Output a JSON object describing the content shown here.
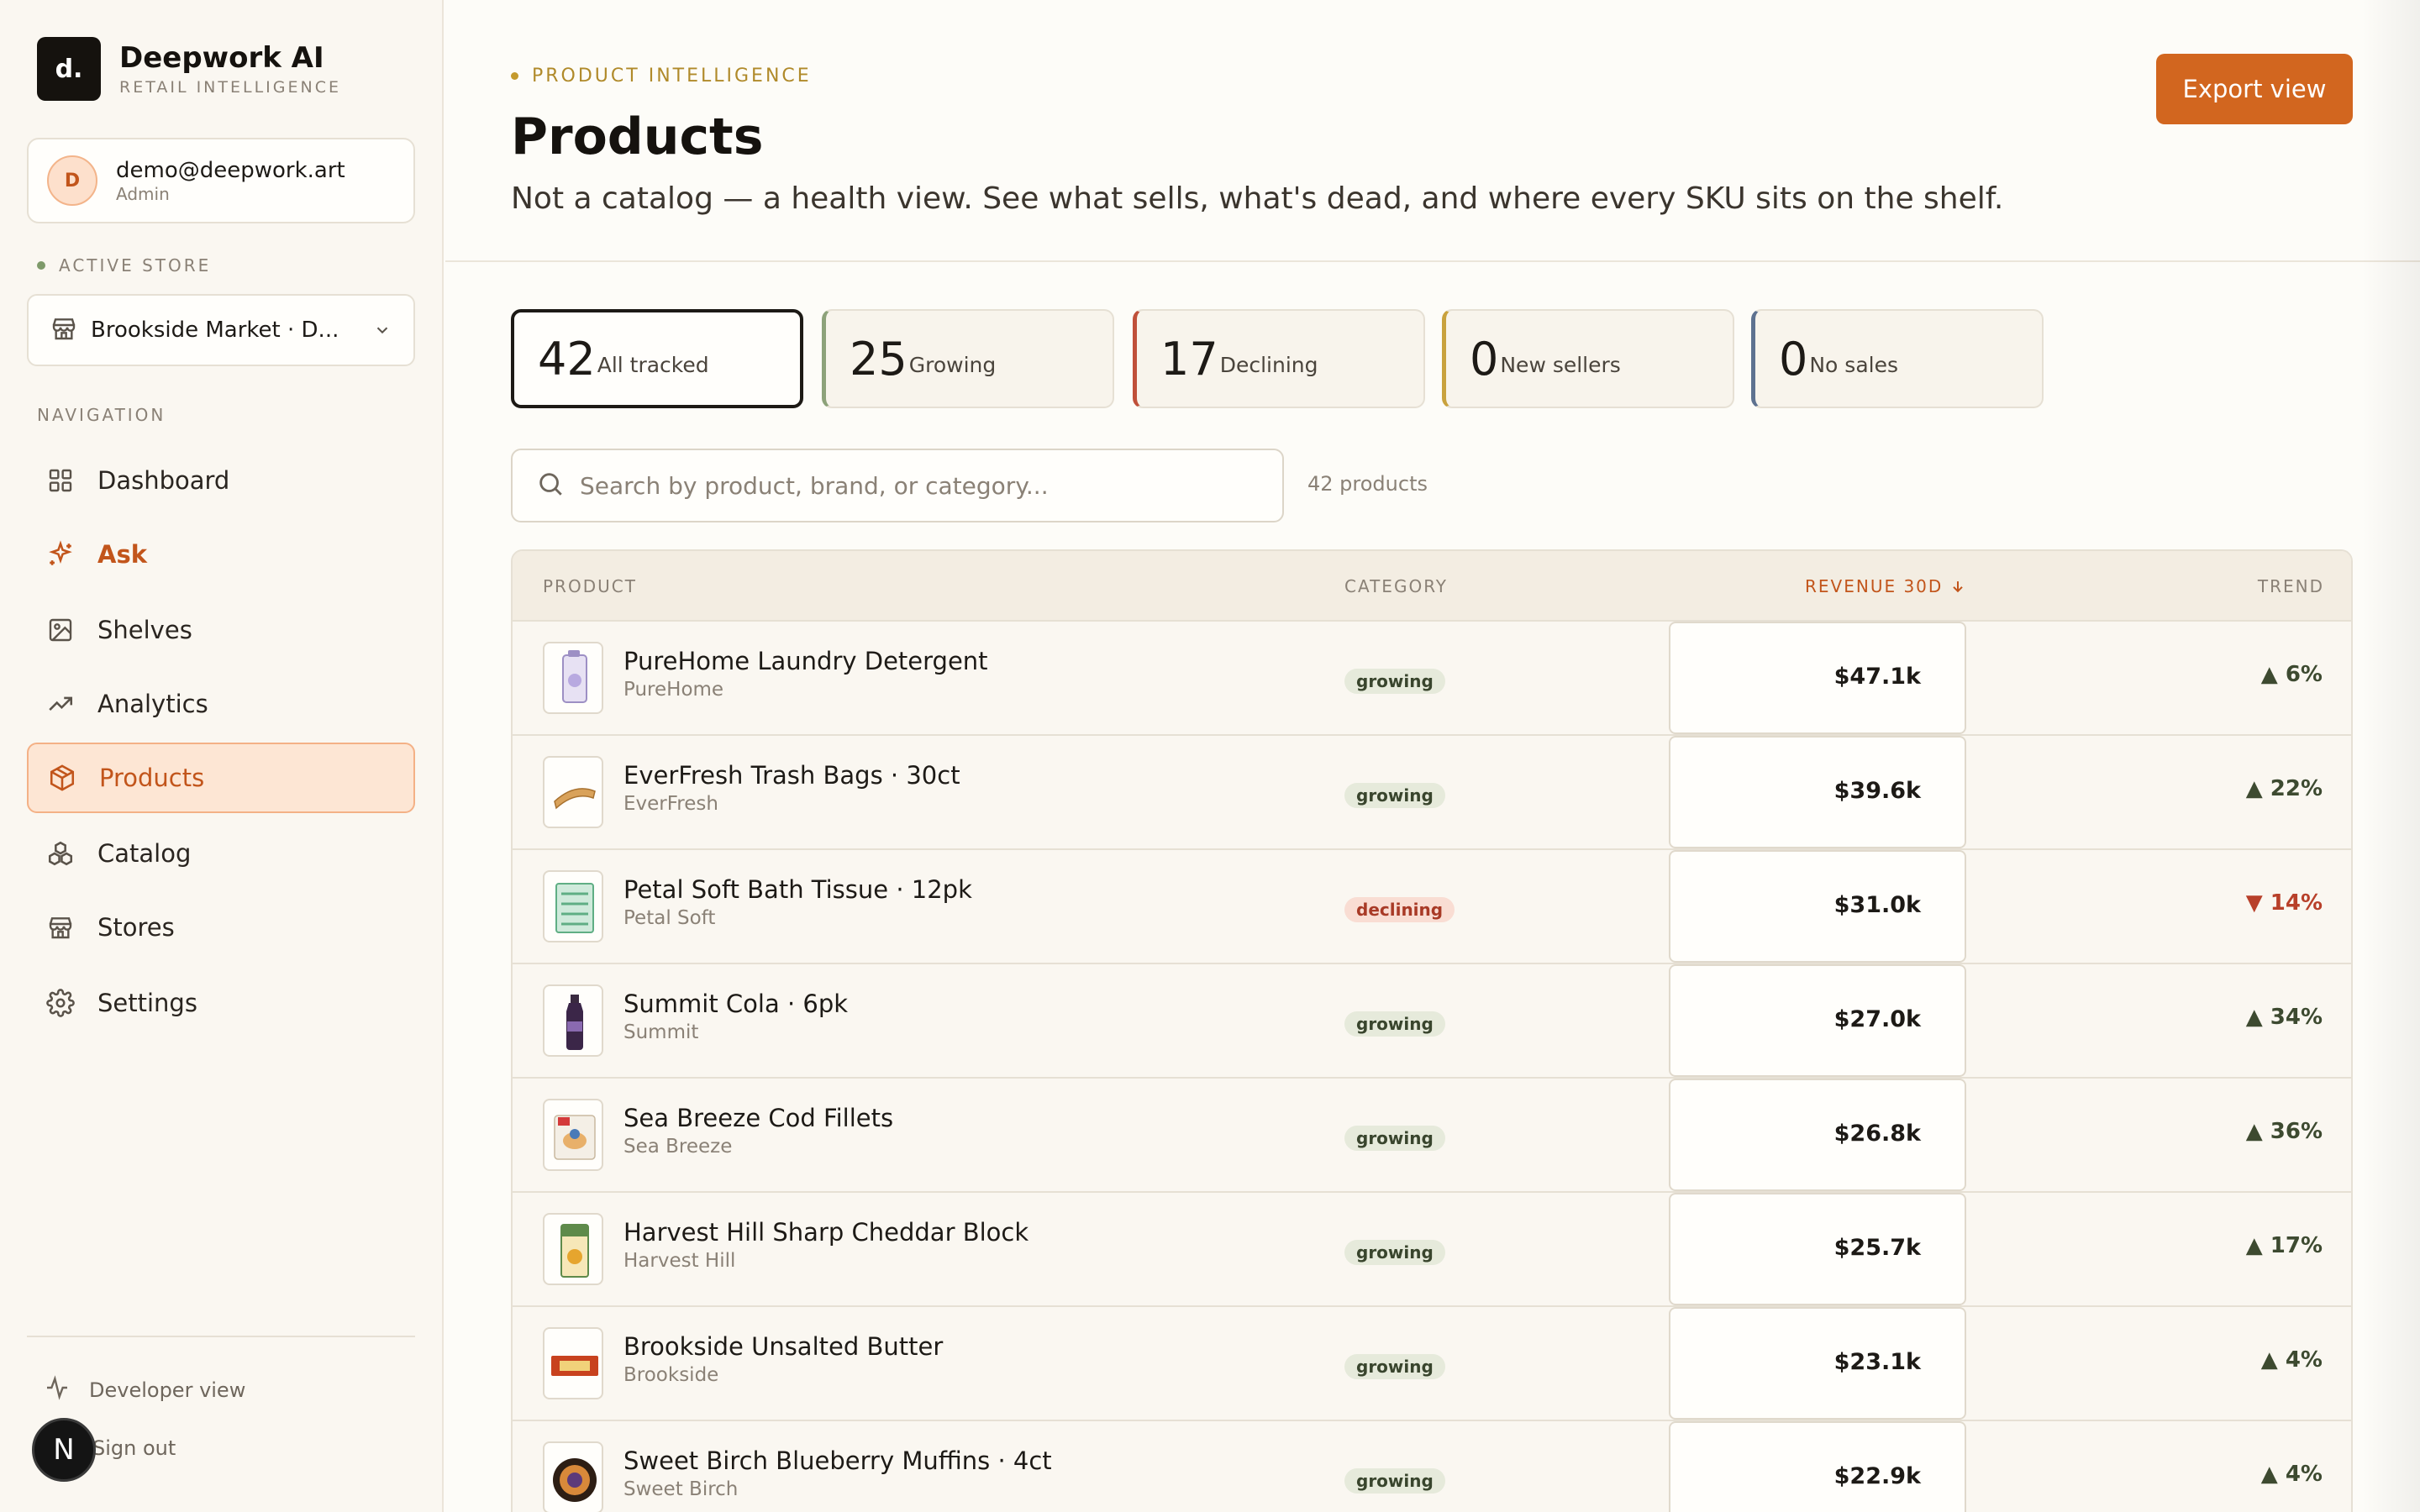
{
  "brand": {
    "logo": "d.",
    "name": "Deepwork AI",
    "subtitle": "RETAIL INTELLIGENCE"
  },
  "user": {
    "initial": "D",
    "email": "demo@deepwork.art",
    "role": "Admin"
  },
  "store": {
    "section_label": "ACTIVE STORE",
    "selected": "Brookside Market · D..."
  },
  "nav": {
    "section_label": "NAVIGATION",
    "items": [
      {
        "label": "Dashboard",
        "icon": "grid-icon"
      },
      {
        "label": "Ask",
        "icon": "sparkle-icon"
      },
      {
        "label": "Shelves",
        "icon": "image-icon"
      },
      {
        "label": "Analytics",
        "icon": "trending-icon"
      },
      {
        "label": "Products",
        "icon": "package-icon"
      },
      {
        "label": "Catalog",
        "icon": "boxes-icon"
      },
      {
        "label": "Stores",
        "icon": "store-icon"
      },
      {
        "label": "Settings",
        "icon": "gear-icon"
      }
    ],
    "active": "Products"
  },
  "footer": {
    "developer_view": "Developer view",
    "sign_out": "Sign out",
    "badge": "N"
  },
  "header": {
    "eyebrow": "PRODUCT INTELLIGENCE",
    "title": "Products",
    "description": "Not a catalog — a health view. See what sells, what's dead, and where every SKU sits on the shelf.",
    "export_label": "Export view"
  },
  "stats": [
    {
      "value": "42",
      "label": "All tracked",
      "accent": "#1d1a16"
    },
    {
      "value": "25",
      "label": "Growing",
      "accent": "#8da27a"
    },
    {
      "value": "17",
      "label": "Declining",
      "accent": "#c0503a"
    },
    {
      "value": "0",
      "label": "New sellers",
      "accent": "#c9a23e"
    },
    {
      "value": "0",
      "label": "No sales",
      "accent": "#5e7290"
    }
  ],
  "search": {
    "placeholder": "Search by product, brand, or category...",
    "count": "42 products"
  },
  "table": {
    "columns": {
      "product": "PRODUCT",
      "category": "CATEGORY",
      "revenue": "REVENUE 30D",
      "trend": "TREND"
    },
    "rows": [
      {
        "name": "PureHome Laundry Detergent",
        "brand": "PureHome",
        "category": "growing",
        "revenue": "$47.1k",
        "trend": "▲ 6%",
        "direction": "up"
      },
      {
        "name": "EverFresh Trash Bags · 30ct",
        "brand": "EverFresh",
        "category": "growing",
        "revenue": "$39.6k",
        "trend": "▲ 22%",
        "direction": "up"
      },
      {
        "name": "Petal Soft Bath Tissue · 12pk",
        "brand": "Petal Soft",
        "category": "declining",
        "revenue": "$31.0k",
        "trend": "▼ 14%",
        "direction": "down"
      },
      {
        "name": "Summit Cola · 6pk",
        "brand": "Summit",
        "category": "growing",
        "revenue": "$27.0k",
        "trend": "▲ 34%",
        "direction": "up"
      },
      {
        "name": "Sea Breeze Cod Fillets",
        "brand": "Sea Breeze",
        "category": "growing",
        "revenue": "$26.8k",
        "trend": "▲ 36%",
        "direction": "up"
      },
      {
        "name": "Harvest Hill Sharp Cheddar Block",
        "brand": "Harvest Hill",
        "category": "growing",
        "revenue": "$25.7k",
        "trend": "▲ 17%",
        "direction": "up"
      },
      {
        "name": "Brookside Unsalted Butter",
        "brand": "Brookside",
        "category": "growing",
        "revenue": "$23.1k",
        "trend": "▲ 4%",
        "direction": "up"
      },
      {
        "name": "Sweet Birch Blueberry Muffins · 4ct",
        "brand": "Sweet Birch",
        "category": "growing",
        "revenue": "$22.9k",
        "trend": "▲ 4%",
        "direction": "up"
      }
    ]
  }
}
